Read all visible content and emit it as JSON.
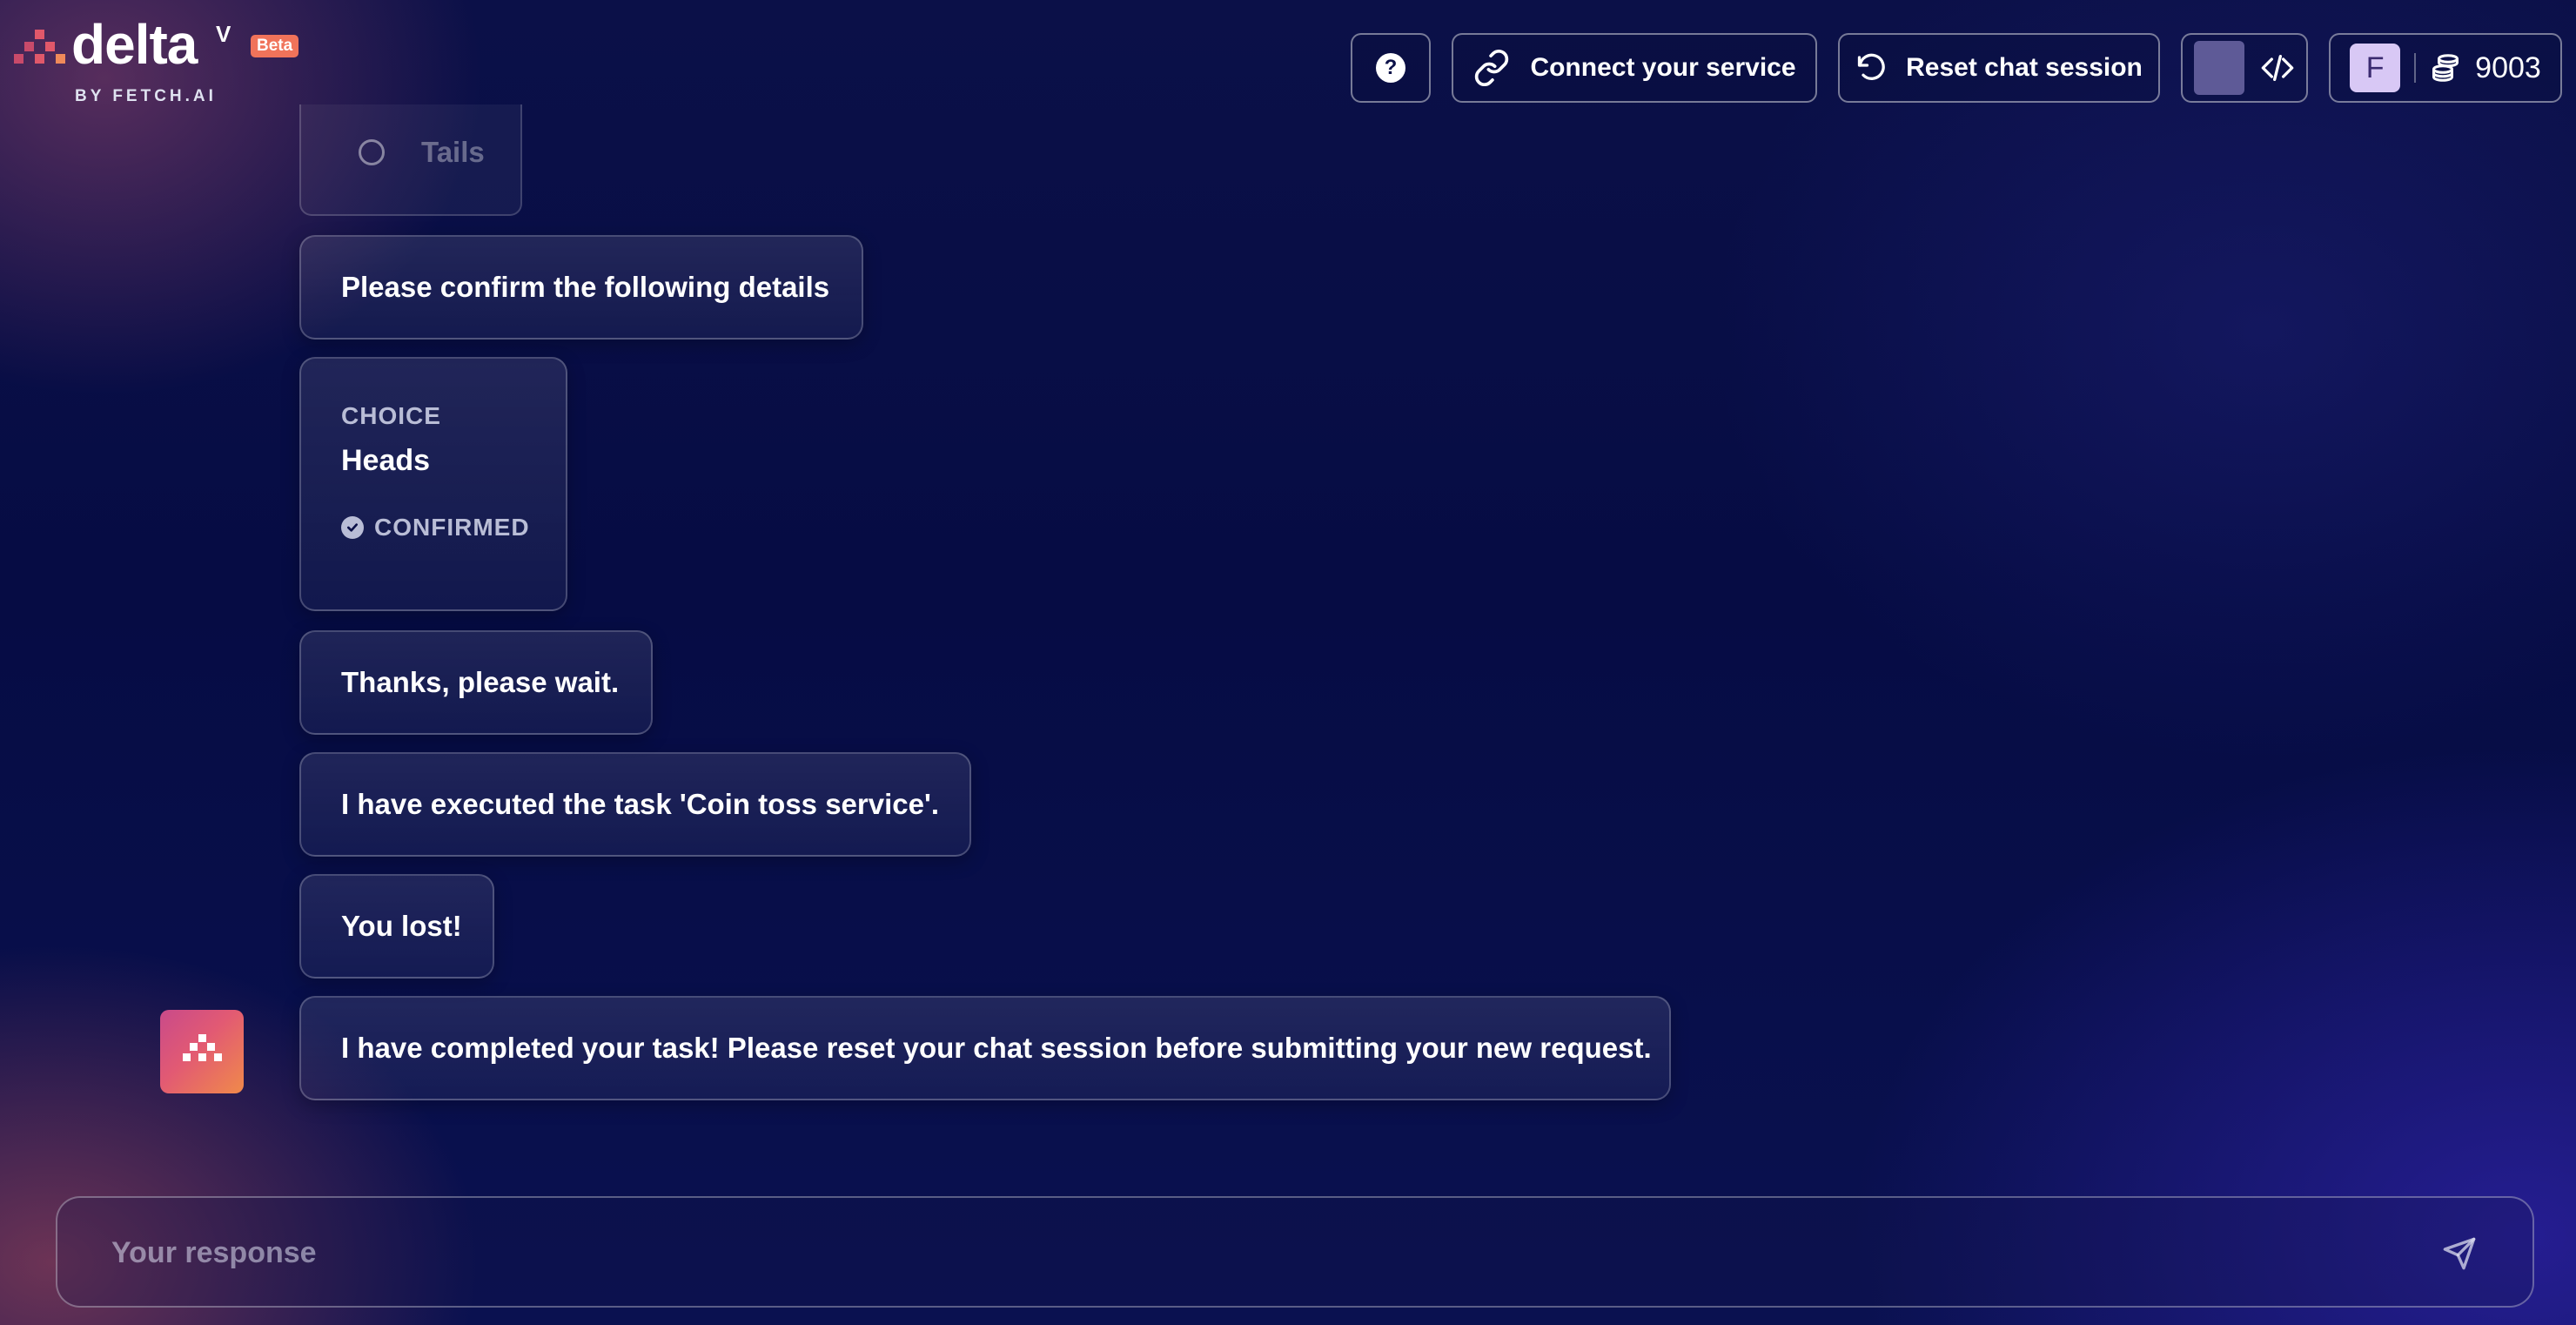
{
  "brand": {
    "name": "delta",
    "superscript": "V",
    "badge": "Beta",
    "byline": "BY FETCH.AI",
    "accent_color": "#f0735a"
  },
  "header": {
    "help_icon": "question-circle-icon",
    "help_label": "?",
    "connect_label": "Connect your service",
    "connect_icon": "link-icon",
    "reset_label": "Reset chat session",
    "reset_icon": "undo-icon",
    "dev_icon": "code-icon",
    "avatar_initial": "F",
    "credits_icon": "coins-icon",
    "credits": "9003"
  },
  "chat": {
    "option_partial": "Tails",
    "confirm_prompt": "Please confirm the following details",
    "choice": {
      "key": "CHOICE",
      "value": "Heads",
      "status": "CONFIRMED"
    },
    "messages": [
      "Thanks, please wait.",
      "I have executed the task 'Coin toss service'.",
      "You lost!",
      "I have completed your task! Please reset your chat session before submitting your new request."
    ],
    "agent_avatar_icon": "deltav-logo-icon"
  },
  "composer": {
    "placeholder": "Your response",
    "value": "",
    "send_icon": "send-icon"
  }
}
